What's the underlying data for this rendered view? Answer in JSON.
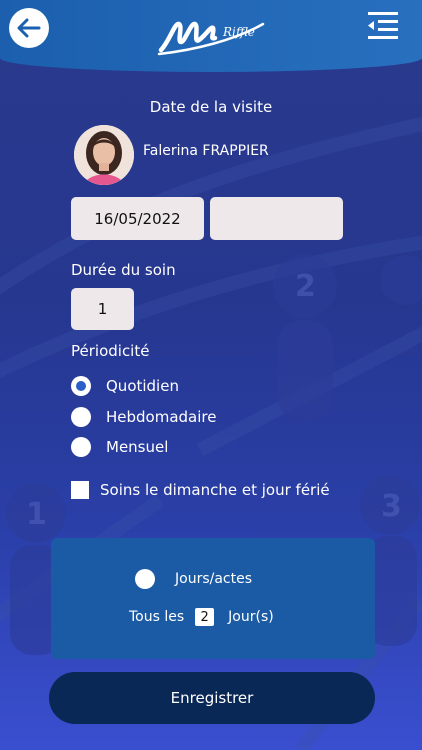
{
  "header": {
    "back_icon": "arrow-left-icon",
    "logo_text": "MyRiffle",
    "menu_icon": "menu-collapse-icon"
  },
  "visit": {
    "title": "Date de la visite",
    "patient_name": "Falerina FRAPPIER",
    "date": "16/05/2022",
    "time": ""
  },
  "duree": {
    "label": "Durée du soin",
    "value": "1"
  },
  "periodicite": {
    "label": "Périodicité",
    "options": [
      {
        "label": "Quotidien",
        "selected": true
      },
      {
        "label": "Hebdomadaire",
        "selected": false
      },
      {
        "label": "Mensuel",
        "selected": false
      }
    ]
  },
  "sunday_option": {
    "label": "Soins le dimanche et jour férié",
    "checked": false
  },
  "frequency": {
    "jours_actes_label": "Jours/actes",
    "tous_les_label": "Tous les",
    "every_value": "2",
    "unit_label": "Jour(s)"
  },
  "actions": {
    "save_label": "Enregistrer"
  },
  "colors": {
    "header": "#1b5fae",
    "background": "#2a3a8c",
    "panel": "#1b5ba6",
    "save_button": "#0a2856",
    "radio_selected": "#2b5fc7"
  }
}
